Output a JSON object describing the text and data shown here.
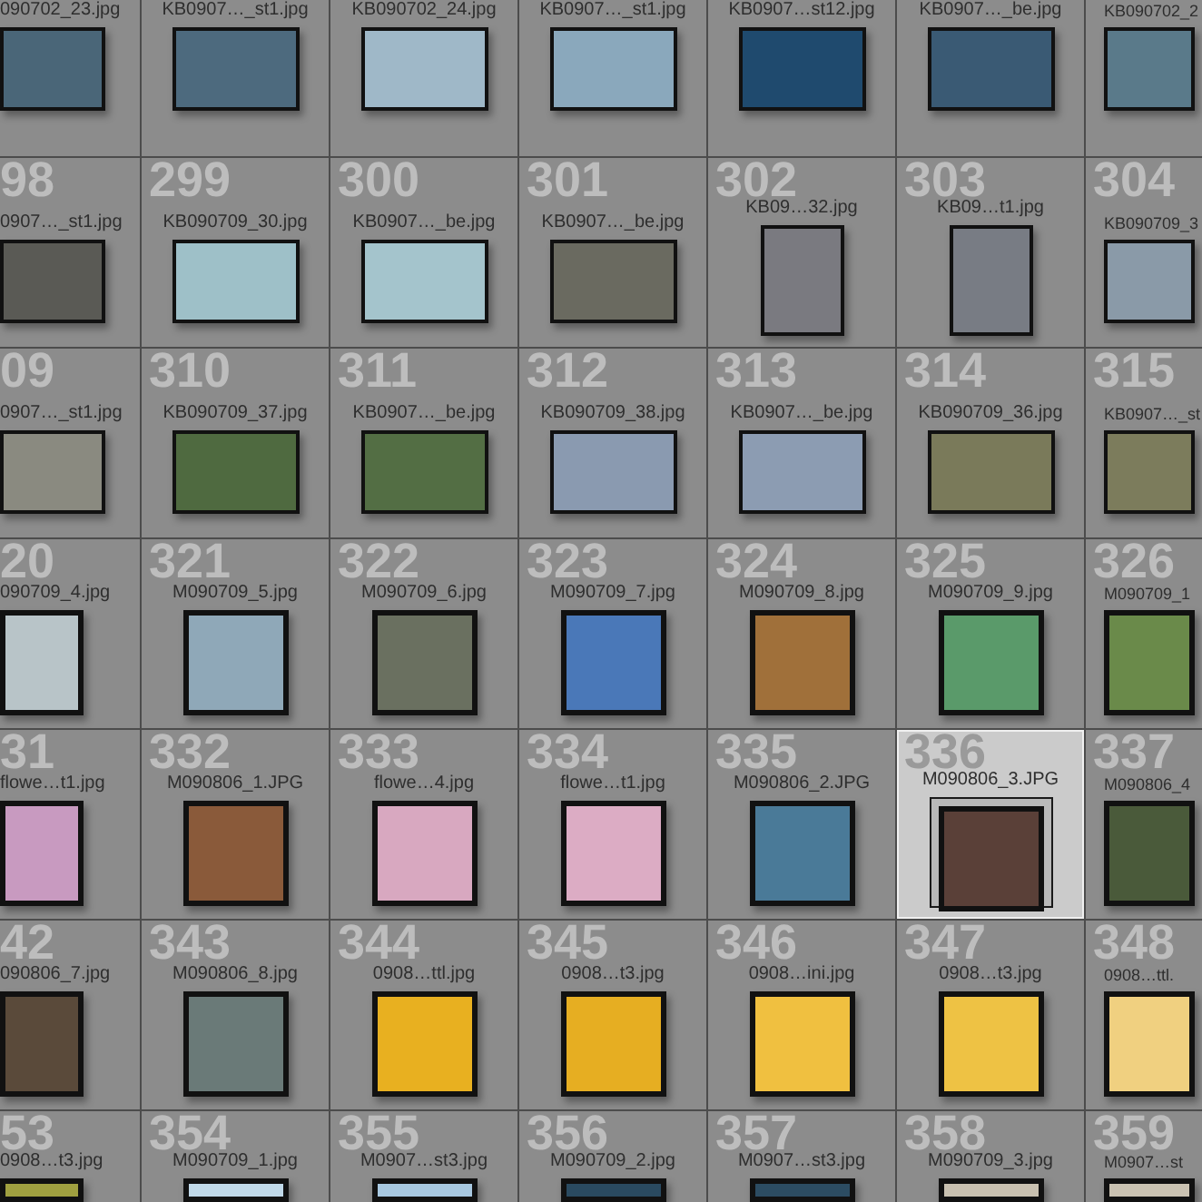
{
  "grid": {
    "rows": [
      {
        "cells": [
          {
            "filename": "090702_23.jpg",
            "kind": "landscape",
            "color": "#4a6678",
            "selected": false
          },
          {
            "filename": "KB0907…_st1.jpg",
            "kind": "landscape",
            "color": "#4d6a7e",
            "selected": false
          },
          {
            "filename": "KB090702_24.jpg",
            "kind": "landscape",
            "color": "#9fb8c8",
            "selected": false
          },
          {
            "filename": "KB0907…_st1.jpg",
            "kind": "landscape",
            "color": "#8aa8bc",
            "selected": false
          },
          {
            "filename": "KB0907…st12.jpg",
            "kind": "landscape",
            "color": "#1f4a6e",
            "selected": false
          },
          {
            "filename": "KB0907…_be.jpg",
            "kind": "landscape",
            "color": "#3a5a74",
            "selected": false
          },
          {
            "filename": "KB090702_2",
            "kind": "landscape",
            "color": "#5a7a8a",
            "selected": false
          }
        ]
      },
      {
        "cells": [
          {
            "number": "98",
            "filename": "0907…_st1.jpg",
            "kind": "landscape",
            "color": "#5a5a55",
            "selected": false
          },
          {
            "number": "299",
            "filename": "KB090709_30.jpg",
            "kind": "landscape",
            "color": "#9ec0c8",
            "selected": false
          },
          {
            "number": "300",
            "filename": "KB0907…_be.jpg",
            "kind": "landscape",
            "color": "#a4c4cc",
            "selected": false
          },
          {
            "number": "301",
            "filename": "KB0907…_be.jpg",
            "kind": "landscape",
            "color": "#6a6a60",
            "selected": false
          },
          {
            "number": "302",
            "filename": "KB09…32.jpg",
            "kind": "portrait",
            "color": "#7a7a80",
            "selected": false
          },
          {
            "number": "303",
            "filename": "KB09…t1.jpg",
            "kind": "portrait",
            "color": "#787c84",
            "selected": false
          },
          {
            "number": "304",
            "filename": "KB090709_3",
            "kind": "landscape",
            "color": "#8a9aa8",
            "selected": false
          }
        ]
      },
      {
        "cells": [
          {
            "number": "09",
            "filename": "0907…_st1.jpg",
            "kind": "landscape",
            "color": "#8a8a80",
            "selected": false
          },
          {
            "number": "310",
            "filename": "KB090709_37.jpg",
            "kind": "landscape",
            "color": "#4f6a40",
            "selected": false
          },
          {
            "number": "311",
            "filename": "KB0907…_be.jpg",
            "kind": "landscape",
            "color": "#536e44",
            "selected": false
          },
          {
            "number": "312",
            "filename": "KB090709_38.jpg",
            "kind": "landscape",
            "color": "#8a9ab0",
            "selected": false
          },
          {
            "number": "313",
            "filename": "KB0907…_be.jpg",
            "kind": "landscape",
            "color": "#8c9cb2",
            "selected": false
          },
          {
            "number": "314",
            "filename": "KB090709_36.jpg",
            "kind": "landscape",
            "color": "#7a7a5a",
            "selected": false
          },
          {
            "number": "315",
            "filename": "KB0907…_st",
            "kind": "landscape",
            "color": "#7c7c5c",
            "selected": false
          }
        ]
      },
      {
        "cells": [
          {
            "number": "20",
            "filename": "090709_4.jpg",
            "kind": "square",
            "color": "#b8c4c8",
            "selected": false
          },
          {
            "number": "321",
            "filename": "M090709_5.jpg",
            "kind": "square",
            "color": "#8fa8b8",
            "selected": false
          },
          {
            "number": "322",
            "filename": "M090709_6.jpg",
            "kind": "square",
            "color": "#6a7060",
            "selected": false
          },
          {
            "number": "323",
            "filename": "M090709_7.jpg",
            "kind": "square",
            "color": "#4a78b8",
            "selected": false
          },
          {
            "number": "324",
            "filename": "M090709_8.jpg",
            "kind": "square",
            "color": "#a0703a",
            "selected": false
          },
          {
            "number": "325",
            "filename": "M090709_9.jpg",
            "kind": "square",
            "color": "#5a9a6a",
            "selected": false
          },
          {
            "number": "326",
            "filename": "M090709_1",
            "kind": "square",
            "color": "#6a8a4a",
            "selected": false
          }
        ]
      },
      {
        "cells": [
          {
            "number": "31",
            "filename": "flowe…t1.jpg",
            "kind": "square",
            "color": "#c89ac0",
            "selected": false
          },
          {
            "number": "332",
            "filename": "M090806_1.JPG",
            "kind": "square",
            "color": "#8a5a3a",
            "selected": false
          },
          {
            "number": "333",
            "filename": "flowe…4.jpg",
            "kind": "square",
            "color": "#d8a8c0",
            "selected": false
          },
          {
            "number": "334",
            "filename": "flowe…t1.jpg",
            "kind": "square",
            "color": "#dcacc4",
            "selected": false
          },
          {
            "number": "335",
            "filename": "M090806_2.JPG",
            "kind": "square",
            "color": "#4a7a98",
            "selected": false
          },
          {
            "number": "336",
            "filename": "M090806_3.JPG",
            "kind": "square",
            "color": "#5a4038",
            "selected": true
          },
          {
            "number": "337",
            "filename": "M090806_4",
            "kind": "square",
            "color": "#4a5a3a",
            "selected": false
          }
        ]
      },
      {
        "cells": [
          {
            "number": "42",
            "filename": "090806_7.jpg",
            "kind": "square",
            "color": "#5a4a3a",
            "selected": false
          },
          {
            "number": "343",
            "filename": "M090806_8.jpg",
            "kind": "square",
            "color": "#6a7a78",
            "selected": false
          },
          {
            "number": "344",
            "filename": "0908…ttl.jpg",
            "kind": "square",
            "color": "#e8b020",
            "selected": false
          },
          {
            "number": "345",
            "filename": "0908…t3.jpg",
            "kind": "square",
            "color": "#e6ae22",
            "selected": false
          },
          {
            "number": "346",
            "filename": "0908…ini.jpg",
            "kind": "square",
            "color": "#f0c040",
            "selected": false
          },
          {
            "number": "347",
            "filename": "0908…t3.jpg",
            "kind": "square",
            "color": "#eec244",
            "selected": false
          },
          {
            "number": "348",
            "filename": "0908…ttl.",
            "kind": "square",
            "color": "#f0d080",
            "selected": false
          }
        ]
      },
      {
        "cells": [
          {
            "number": "53",
            "filename": "0908…t3.jpg",
            "kind": "square",
            "color": "#a0a040",
            "selected": false
          },
          {
            "number": "354",
            "filename": "M090709_1.jpg",
            "kind": "square",
            "color": "#c0d8e8",
            "selected": false
          },
          {
            "number": "355",
            "filename": "M0907…st3.jpg",
            "kind": "square",
            "color": "#a8c8e0",
            "selected": false
          },
          {
            "number": "356",
            "filename": "M090709_2.jpg",
            "kind": "square",
            "color": "#2a4a60",
            "selected": false
          },
          {
            "number": "357",
            "filename": "M0907…st3.jpg",
            "kind": "square",
            "color": "#2c4c62",
            "selected": false
          },
          {
            "number": "358",
            "filename": "M090709_3.jpg",
            "kind": "square",
            "color": "#c8c0b0",
            "selected": false
          },
          {
            "number": "359",
            "filename": "M0907…st",
            "kind": "square",
            "color": "#cac2b2",
            "selected": false
          }
        ]
      }
    ]
  }
}
